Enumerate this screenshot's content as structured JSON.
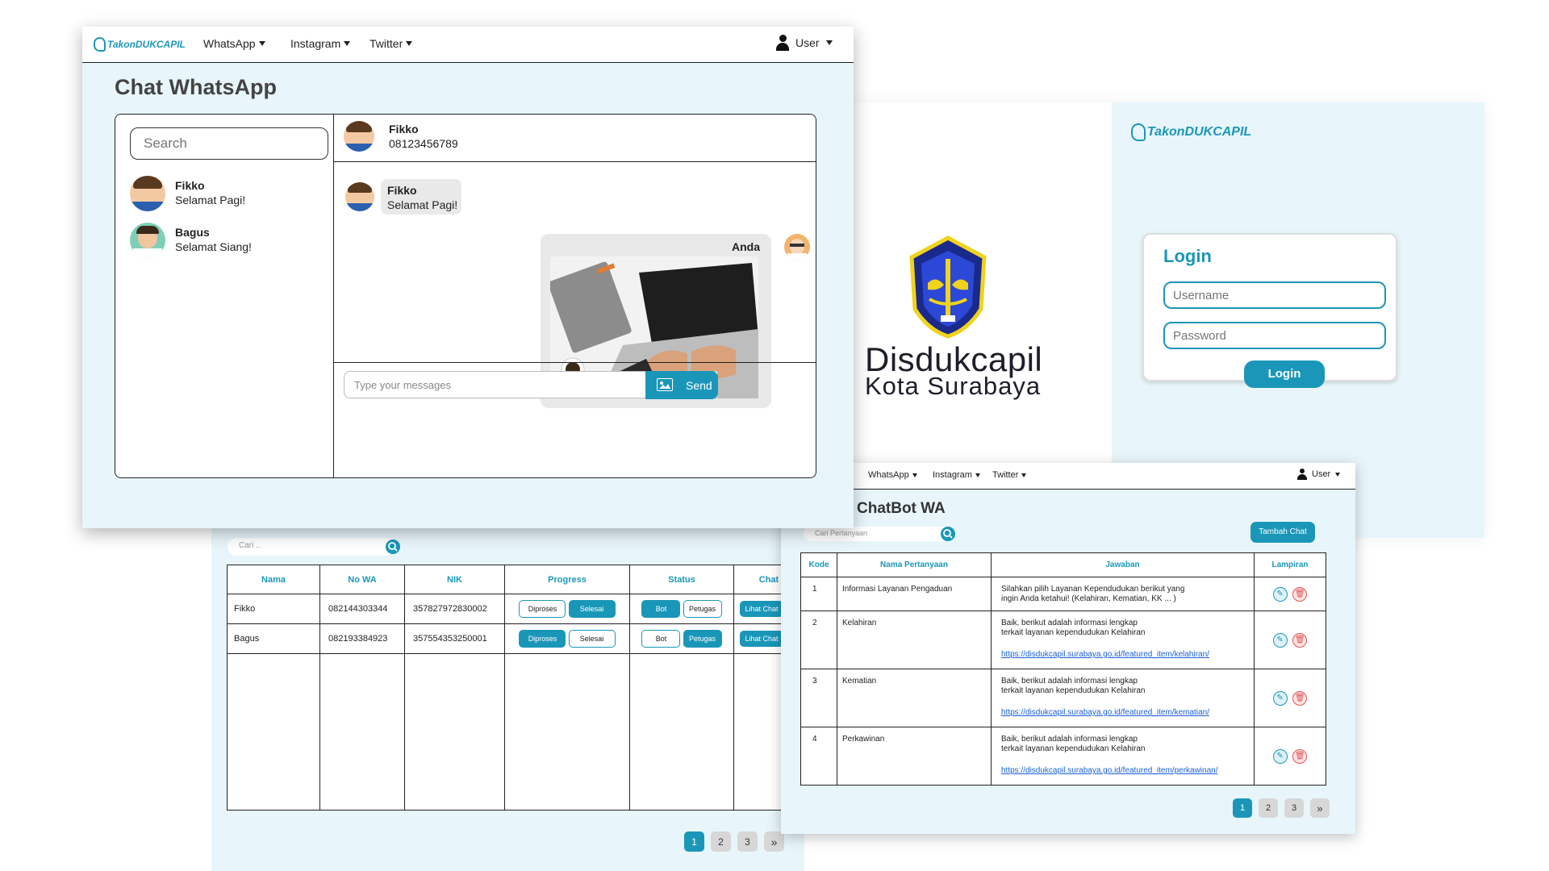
{
  "chat_window": {
    "brand": "TakonDUKCAPIL",
    "nav": [
      {
        "label": "WhatsApp"
      },
      {
        "label": "Instagram"
      },
      {
        "label": "Twitter"
      }
    ],
    "user_label": "User",
    "title": "Chat WhatsApp",
    "search_placeholder": "Search",
    "contacts": [
      {
        "name": "Fikko",
        "message": "Selamat Pagi!"
      },
      {
        "name": "Bagus",
        "message": "Selamat Siang!"
      }
    ],
    "active_contact": {
      "name": "Fikko",
      "phone": "08123456789"
    },
    "incoming": {
      "name": "Fikko",
      "message": "Selamat Pagi!"
    },
    "outgoing": {
      "name": "Anda"
    },
    "message_placeholder": "Type your messages",
    "send_label": "Send"
  },
  "login_window": {
    "org_name": "Disdukcapil",
    "org_city": "Kota Surabaya",
    "brand": "TakonDUKCAPIL",
    "title": "Login",
    "username_placeholder": "Username",
    "password_placeholder": "Password",
    "login_button": "Login"
  },
  "data_window": {
    "search_placeholder": "Cari ..",
    "columns": [
      "Nama",
      "No WA",
      "NIK",
      "Progress",
      "Status",
      "Chat"
    ],
    "rows": [
      {
        "nama": "Fikko",
        "no_wa": "082144303344",
        "nik": "357827972830002",
        "progress": [
          "Diproses",
          "Selesai"
        ],
        "progress_active": "Selesai",
        "status": [
          "Bot",
          "Petugas"
        ],
        "status_active": "Bot",
        "chat": "Lihat Chat"
      },
      {
        "nama": "Bagus",
        "no_wa": "082193384923",
        "nik": "357554353250001",
        "progress": [
          "Diproses",
          "Selesai"
        ],
        "progress_active": "Diproses",
        "status": [
          "Bot",
          "Petugas"
        ],
        "status_active": "Petugas",
        "chat": "Lihat Chat"
      }
    ],
    "pages": [
      "1",
      "2",
      "3"
    ],
    "next_label": "»"
  },
  "chatbot_window": {
    "nav": [
      {
        "label": "WhatsApp"
      },
      {
        "label": "Instagram"
      },
      {
        "label": "Twitter"
      }
    ],
    "user_label": "User",
    "title": "ChatBot WA",
    "search_placeholder": "Cari Pertanyaan",
    "add_button": "Tambah Chat",
    "columns": [
      "Kode",
      "Nama Pertanyaan",
      "Jawaban",
      "Lampiran"
    ],
    "rows": [
      {
        "kode": "1",
        "nama": "Informasi Layanan Pengaduan",
        "jawaban_1": "Silahkan pilih Layanan Kependudukan berikut yang",
        "jawaban_2": "ingin Anda ketahui! (Kelahiran, Kematian, KK ... )",
        "link": ""
      },
      {
        "kode": "2",
        "nama": "Kelahiran",
        "jawaban_1": "Baik, berikut adalah informasi lengkap",
        "jawaban_2": "terkait layanan kependudukan Kelahiran",
        "link": "https://disdukcapil.surabaya.go.id/featured_item/kelahiran/"
      },
      {
        "kode": "3",
        "nama": "Kematian",
        "jawaban_1": "Baik, berikut adalah informasi lengkap",
        "jawaban_2": "terkait layanan kependudukan Kelahiran",
        "link": "https://disdukcapil.surabaya.go.id/featured_item/kematian/"
      },
      {
        "kode": "4",
        "nama": "Perkawinan",
        "jawaban_1": "Baik, berikut adalah informasi lengkap",
        "jawaban_2": "terkait layanan kependudukan Kelahiran",
        "link": "https://disdukcapil.surabaya.go.id/featured_item/perkawinan/"
      }
    ],
    "pages": [
      "1",
      "2",
      "3"
    ],
    "next_label": "»"
  },
  "colors": {
    "accent": "#1a97b8",
    "panel": "#e8f6fb",
    "danger": "#e05555"
  }
}
